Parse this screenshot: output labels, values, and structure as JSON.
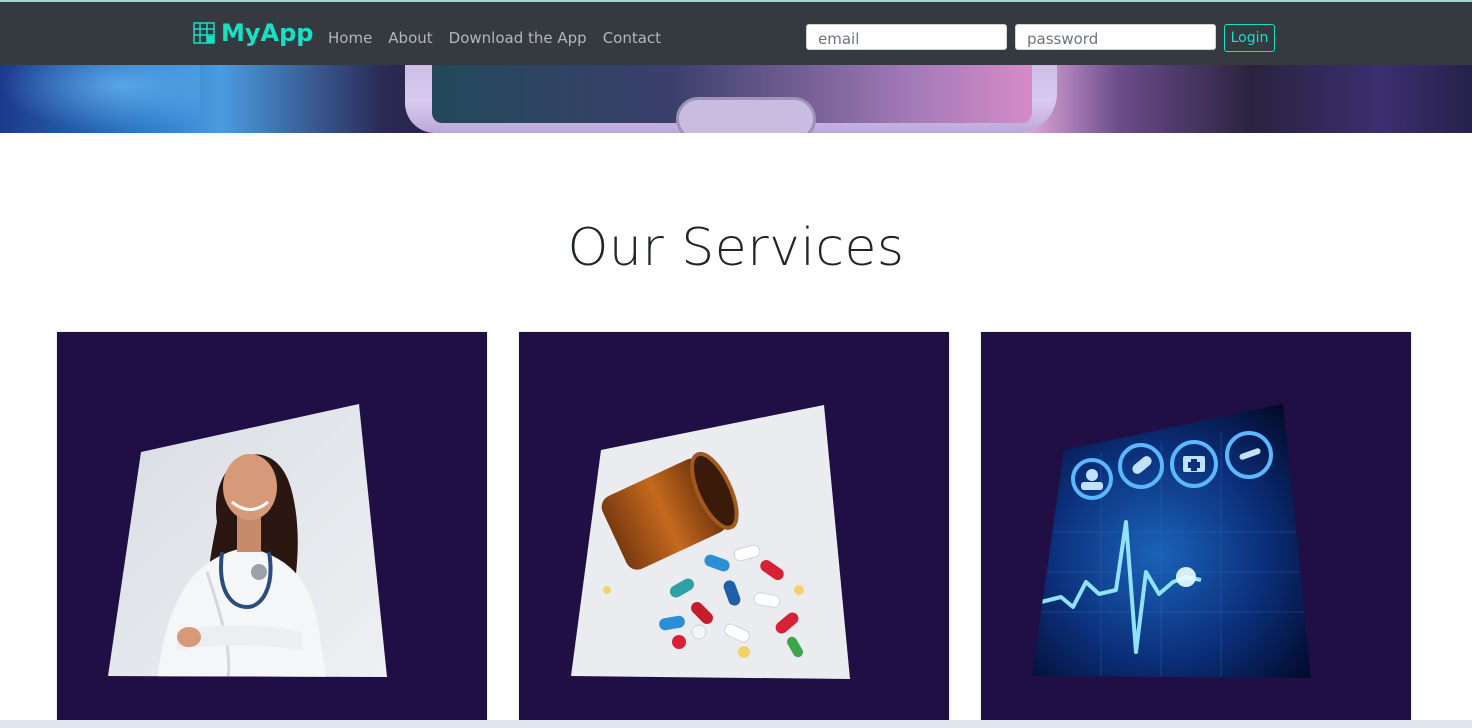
{
  "navbar": {
    "brand": "MyApp",
    "links": [
      "Home",
      "About",
      "Download the App",
      "Contact"
    ],
    "email_placeholder": "email",
    "password_placeholder": "password",
    "login_label": "Login"
  },
  "services": {
    "title": "Our Services",
    "cards": [
      {
        "icon": "doctor-image"
      },
      {
        "icon": "pills-image"
      },
      {
        "icon": "heartbeat-image"
      }
    ]
  },
  "colors": {
    "accent": "#17e0c4",
    "navbar_bg": "#343a40",
    "card_bg": "#200f45"
  }
}
